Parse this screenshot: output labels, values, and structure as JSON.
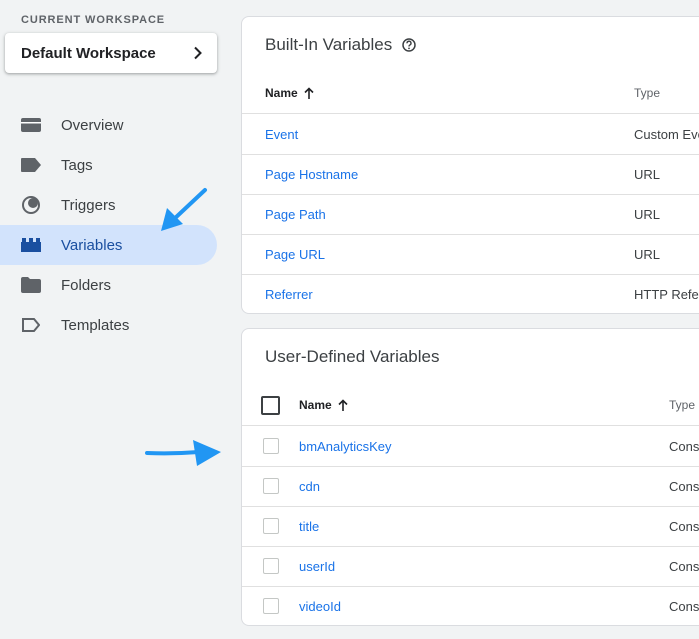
{
  "sidebar": {
    "workspace_label": "CURRENT WORKSPACE",
    "workspace_name": "Default Workspace",
    "items": [
      {
        "label": "Overview",
        "icon": "overview-icon"
      },
      {
        "label": "Tags",
        "icon": "tag-icon"
      },
      {
        "label": "Triggers",
        "icon": "trigger-icon"
      },
      {
        "label": "Variables",
        "icon": "variables-icon",
        "active": true
      },
      {
        "label": "Folders",
        "icon": "folder-icon"
      },
      {
        "label": "Templates",
        "icon": "template-icon"
      }
    ]
  },
  "builtin": {
    "title": "Built-In Variables",
    "col_name": "Name",
    "col_type": "Type",
    "rows": [
      {
        "name": "Event",
        "type": "Custom Eve"
      },
      {
        "name": "Page Hostname",
        "type": "URL"
      },
      {
        "name": "Page Path",
        "type": "URL"
      },
      {
        "name": "Page URL",
        "type": "URL"
      },
      {
        "name": "Referrer",
        "type": "HTTP Refe"
      }
    ]
  },
  "user_defined": {
    "title": "User-Defined Variables",
    "col_name": "Name",
    "col_type": "Type",
    "rows": [
      {
        "name": "bmAnalyticsKey",
        "type": "Cons"
      },
      {
        "name": "cdn",
        "type": "Cons"
      },
      {
        "name": "title",
        "type": "Cons"
      },
      {
        "name": "userId",
        "type": "Cons"
      },
      {
        "name": "videoId",
        "type": "Cons"
      }
    ]
  },
  "colors": {
    "accent": "#1a73e8",
    "active_bg": "#d2e3fc",
    "annotation_arrow": "#2196f3"
  }
}
